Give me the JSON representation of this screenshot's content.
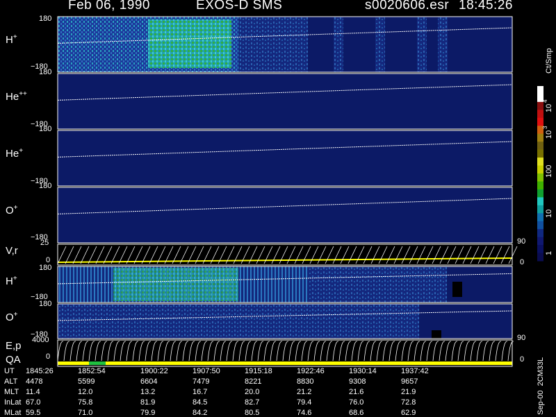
{
  "header": {
    "date": "Feb 06, 1990",
    "instrument": "EXOS-D SMS",
    "file": "s0020606.esr",
    "time": "18:45:26"
  },
  "panels": [
    {
      "id": "h-plus",
      "species": "H",
      "charge": "+",
      "y_top": "180",
      "y_bottom": "−180"
    },
    {
      "id": "he-pp",
      "species": "He",
      "charge": "++",
      "y_top": "180",
      "y_bottom": "−180"
    },
    {
      "id": "he-plus",
      "species": "He",
      "charge": "+",
      "y_top": "180",
      "y_bottom": "−180"
    },
    {
      "id": "o-plus",
      "species": "O",
      "charge": "+",
      "y_top": "180",
      "y_bottom": "−180"
    },
    {
      "id": "vr",
      "label": "V,r",
      "y_top": "25",
      "y_bottom": "0",
      "r_top": "90",
      "r_bottom": "0"
    },
    {
      "id": "h-plus-2",
      "species": "H",
      "charge": "+",
      "y_top": "180",
      "y_bottom": "−180"
    },
    {
      "id": "o-plus-2",
      "species": "O",
      "charge": "+",
      "y_top": "180",
      "y_bottom": "−180"
    },
    {
      "id": "ep",
      "label": "E,p",
      "label2": "QA",
      "y_top": "4000",
      "y_bottom": "0",
      "r_top": "90",
      "r_bottom": "0"
    }
  ],
  "colorbar": {
    "unit": "Ct/Smp",
    "labels": [
      "10",
      "4",
      "10",
      "3",
      "100",
      "10",
      "1"
    ],
    "colors": [
      "#ffffff",
      "#ffffff",
      "#8a1010",
      "#c01010",
      "#e01010",
      "#d06010",
      "#a08010",
      "#706010",
      "#787000",
      "#e0e020",
      "#c8d000",
      "#80c000",
      "#40b000",
      "#10a030",
      "#20c8c0",
      "#10a0a0",
      "#1070b0",
      "#1050a0",
      "#102880",
      "#101870",
      "#0a1060",
      "#0a0c50"
    ]
  },
  "chart_data": {
    "type": "heatmap",
    "title": "Feb 06, 1990   EXOS-D SMS",
    "x": [
      "1845:26",
      "1852:54",
      "1900:22",
      "1907:50",
      "1915:18",
      "1922:46",
      "1930:14",
      "1937:42"
    ],
    "ephemeris": [
      {
        "name": "UT",
        "values": [
          "1845:26",
          "1852:54",
          "1900:22",
          "1907:50",
          "1915:18",
          "1922:46",
          "1930:14",
          "1937:42"
        ]
      },
      {
        "name": "ALT",
        "values": [
          "4478",
          "5599",
          "6604",
          "7479",
          "8221",
          "8830",
          "9308",
          "9657"
        ]
      },
      {
        "name": "MLT",
        "values": [
          "11.4",
          "12.0",
          "13.2",
          "16.7",
          "20.0",
          "21.2",
          "21.6",
          "21.9"
        ]
      },
      {
        "name": "InLat",
        "values": [
          "67.0",
          "75.8",
          "81.9",
          "84.5",
          "82.7",
          "79.4",
          "76.0",
          "72.8"
        ]
      },
      {
        "name": "MLat",
        "values": [
          "59.5",
          "71.0",
          "79.9",
          "84.2",
          "80.5",
          "74.6",
          "68.6",
          "62.9"
        ]
      }
    ],
    "y_range": [
      -180,
      180
    ],
    "colorscale_range": [
      1,
      10000
    ],
    "colorscale_log": true
  },
  "credit": "Sep-00  2CM33L"
}
